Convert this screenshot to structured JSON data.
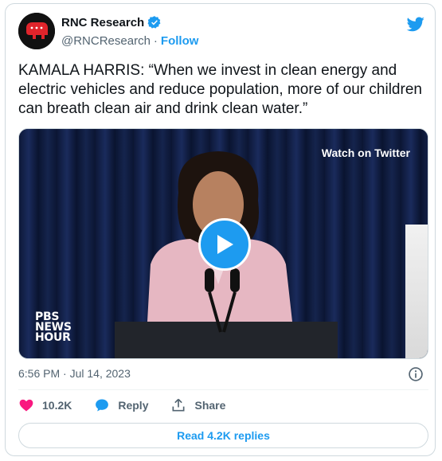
{
  "author": {
    "name": "RNC Research",
    "handle": "@RNCResearch",
    "separator": "·",
    "follow_label": "Follow"
  },
  "tweet": {
    "text": "KAMALA HARRIS: “When we invest in clean energy and electric vehicles and reduce population, more of our children can breath clean air and drink clean water.”"
  },
  "media": {
    "watch_label": "Watch on Twitter",
    "watermark_lines": [
      "PBS",
      "NEWS",
      "HOUR"
    ]
  },
  "timestamp": "6:56 PM · Jul 14, 2023",
  "actions": {
    "likes": "10.2K",
    "reply_label": "Reply",
    "share_label": "Share"
  },
  "read_replies_label": "Read 4.2K replies",
  "colors": {
    "accent": "#1d9bf0",
    "like": "#f91880",
    "muted": "#536471"
  }
}
